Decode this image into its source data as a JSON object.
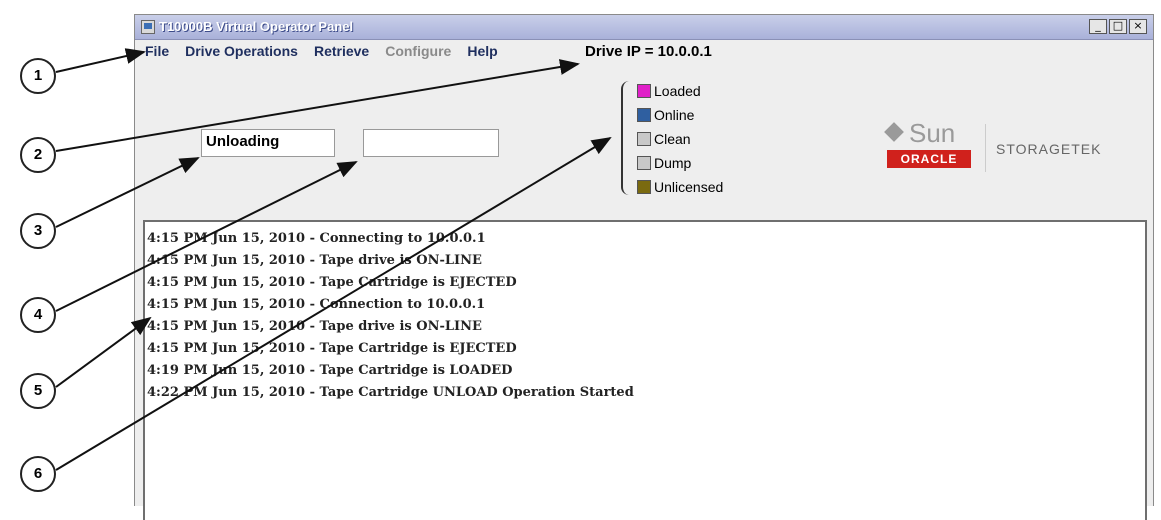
{
  "window": {
    "title": "T10000B Virtual Operator Panel",
    "minimize": "_",
    "maximize": "□",
    "close": "×"
  },
  "menubar": {
    "items": [
      "File",
      "Drive Operations",
      "Retrieve",
      "Configure",
      "Help"
    ],
    "drive_ip": "Drive IP = 10.0.0.1"
  },
  "status": {
    "field1": "Unloading",
    "field2": ""
  },
  "legend": {
    "items": [
      {
        "label": "Loaded",
        "color": "#e020c8"
      },
      {
        "label": "Online",
        "color": "#2f5fa0"
      },
      {
        "label": "Clean",
        "color": "#c8c8c8"
      },
      {
        "label": "Dump",
        "color": "#c8c8c8"
      },
      {
        "label": "Unlicensed",
        "color": "#7a6a10"
      }
    ]
  },
  "logo": {
    "sun": "Sun",
    "oracle": "ORACLE",
    "storagetek": "STORAGETEK"
  },
  "log": {
    "lines": [
      "4:15 PM Jun 15, 2010 - Connecting to 10.0.0.1",
      "4:15 PM Jun 15, 2010 - Tape drive is ON-LINE",
      "4:15 PM Jun 15, 2010 - Tape Cartridge is EJECTED",
      "4:15 PM Jun 15, 2010 - Connection to 10.0.0.1",
      "4:15 PM Jun 15, 2010 - Tape drive is ON-LINE",
      "4:15 PM Jun 15, 2010 - Tape Cartridge is EJECTED",
      "4:19 PM Jun 15, 2010 - Tape Cartridge is LOADED",
      "4:22 PM Jun 15, 2010 - Tape Cartridge UNLOAD Operation Started"
    ]
  },
  "callouts": [
    "1",
    "2",
    "3",
    "4",
    "5",
    "6"
  ]
}
